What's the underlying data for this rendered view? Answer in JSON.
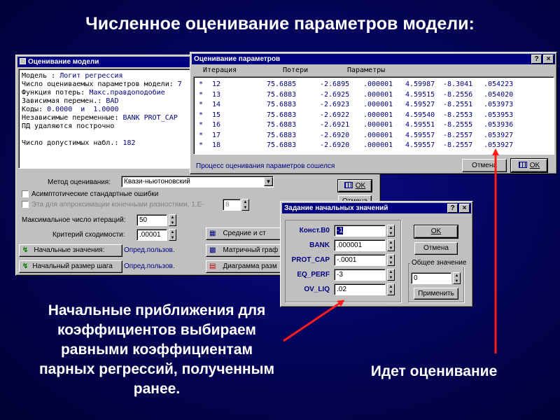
{
  "slide": {
    "title": "Численное оценивание параметров модели:",
    "caption_left": [
      "Начальные приближения для",
      "коэффициентов выбираем",
      "равными коэффициентам",
      "парных регрессий, полученным",
      "ранее."
    ],
    "caption_right": "Идет оценивание"
  },
  "model_window": {
    "title": "Оценивание модели",
    "info_lines": [
      {
        "label": "Модель :",
        "value": "Логит регрессия"
      },
      {
        "label": "Число оцениваемых параметров модели:",
        "value": "7"
      },
      {
        "label": "Функция потерь:",
        "value": "Макс.правдоподобие"
      },
      {
        "label": "Зависимая перемен.:",
        "value": "BAD"
      },
      {
        "label": "Коды:",
        "value": "0.0000  и  1.0000"
      },
      {
        "label": "Независимые переменные:",
        "value": "BANK PROT_CAP"
      },
      {
        "label": "ПД удаляются построчно",
        "value": ""
      },
      {
        "label": "",
        "value": ""
      },
      {
        "label": "Число допустимых набл.:",
        "value": "182"
      }
    ],
    "method_label": "Метод оценивания:",
    "method_value": "Квази-ньютоновский",
    "asym_label": "Асимптотические стандартные ошибки",
    "eta_label": "Эта для аппроксимации конечными разностями, 1.E-",
    "eta_value": "8",
    "max_iter_label": "Максимальное число итераций:",
    "max_iter_value": "50",
    "conv_label": "Критерий сходимости:",
    "conv_value": ".00001",
    "init_values_button": "Начальные значения:",
    "init_values_status": "Опред.пользов.",
    "init_step_button": "Начальный размер шага",
    "init_step_status": "Опред.пользов.",
    "means_button": "Средние и ст",
    "matrix_button": "Матричный граф",
    "diagram_button": "Диаграмма разм",
    "ok_label": "OK",
    "cancel_label": "Отмена"
  },
  "param_window": {
    "title": "Оценивание параметров",
    "help_label": "?",
    "close_label": "×",
    "headers": {
      "iteration": "Итерация",
      "loss": "Потери",
      "params": "Параметры"
    },
    "rows": [
      {
        "marker": "*",
        "iter": "12",
        "loss": "75.6885",
        "p1": "-2.6895",
        "p2": ".000001",
        "p3": "4.59987",
        "p4": "-8.3041",
        "p5": ".054223"
      },
      {
        "marker": "*",
        "iter": "13",
        "loss": "75.6883",
        "p1": "-2.6925",
        "p2": ".000001",
        "p3": "4.59515",
        "p4": "-8.2556",
        "p5": ".054020"
      },
      {
        "marker": "*",
        "iter": "14",
        "loss": "75.6883",
        "p1": "-2.6923",
        "p2": ".000001",
        "p3": "4.59527",
        "p4": "-8.2551",
        "p5": ".053973"
      },
      {
        "marker": "*",
        "iter": "15",
        "loss": "75.6883",
        "p1": "-2.6922",
        "p2": ".000001",
        "p3": "4.59540",
        "p4": "-8.2553",
        "p5": ".053953"
      },
      {
        "marker": "*",
        "iter": "16",
        "loss": "75.6883",
        "p1": "-2.6921",
        "p2": ".000001",
        "p3": "4.59551",
        "p4": "-8.2555",
        "p5": ".053936"
      },
      {
        "marker": "*",
        "iter": "17",
        "loss": "75.6883",
        "p1": "-2.6920",
        "p2": ".000001",
        "p3": "4.59557",
        "p4": "-8.2557",
        "p5": ".053927"
      },
      {
        "marker": "*",
        "iter": "18",
        "loss": "75.6883",
        "p1": "-2.6920",
        "p2": ".000001",
        "p3": "4.59557",
        "p4": "-8.2557",
        "p5": ".053927"
      }
    ],
    "status": "Процесс оценивания параметров сошелся",
    "cancel_label": "Отмена",
    "ok_label": "OK"
  },
  "init_window": {
    "title": "Задание начальных значений",
    "help_label": "?",
    "close_label": "×",
    "fields": [
      {
        "label": "Конст.B0",
        "value": "-1"
      },
      {
        "label": "BANK",
        "value": ".000001"
      },
      {
        "label": "PROT_CAP",
        "value": "-.0001"
      },
      {
        "label": "EQ_PERF",
        "value": "-3"
      },
      {
        "label": "OV_LIQ",
        "value": ".02"
      }
    ],
    "ok_label": "OK",
    "cancel_label": "Отмена",
    "common_label": "Общее значение",
    "common_value": "0",
    "apply_label": "Применить"
  },
  "colors": {
    "arrow": "#ff1a1a",
    "titlebar": "#000080",
    "window": "#c0c0c0",
    "list_text": "#000080"
  }
}
